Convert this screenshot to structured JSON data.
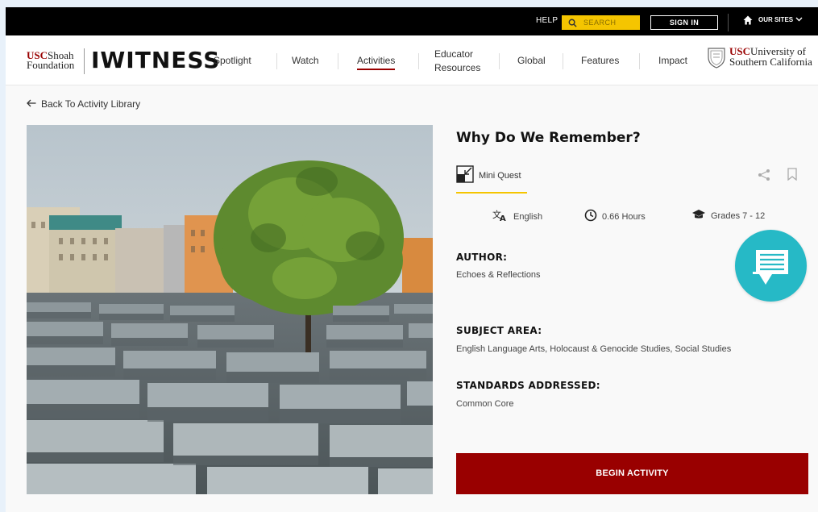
{
  "utility_bar": {
    "help": "HELP",
    "search": "SEARCH",
    "sign_in": "SIGN IN",
    "our_sites": "OUR SITES"
  },
  "header": {
    "logo_usc_bold": "USC",
    "logo_usc_rest": "Shoah",
    "logo_foundation": "Foundation",
    "brand": "IWITNESS",
    "nav": {
      "spotlight": "Spotlight",
      "watch": "Watch",
      "activities": "Activities",
      "educator_line1": "Educator",
      "educator_line2": "Resources",
      "global": "Global",
      "features": "Features",
      "impact": "Impact"
    },
    "usc_bold": "USC",
    "usc_line1": "University of",
    "usc_line2": "Southern California"
  },
  "main": {
    "back_link": "Back To Activity Library",
    "title": "Why Do We Remember?",
    "activity_type": "Mini Quest",
    "language": "English",
    "duration": "0.66 Hours",
    "grades": "Grades 7 - 12",
    "author_label": "AUTHOR:",
    "author": "Echoes & Reflections",
    "subject_label": "SUBJECT AREA:",
    "subject": "English Language Arts, Holocaust & Genocide Studies, Social Studies",
    "standards_label": "STANDARDS ADDRESSED:",
    "standards": "Common Core",
    "begin_button": "BEGIN ACTIVITY"
  },
  "colors": {
    "accent": "#990000",
    "search_yellow": "#f5c500",
    "chat_teal": "#26b9c6"
  }
}
